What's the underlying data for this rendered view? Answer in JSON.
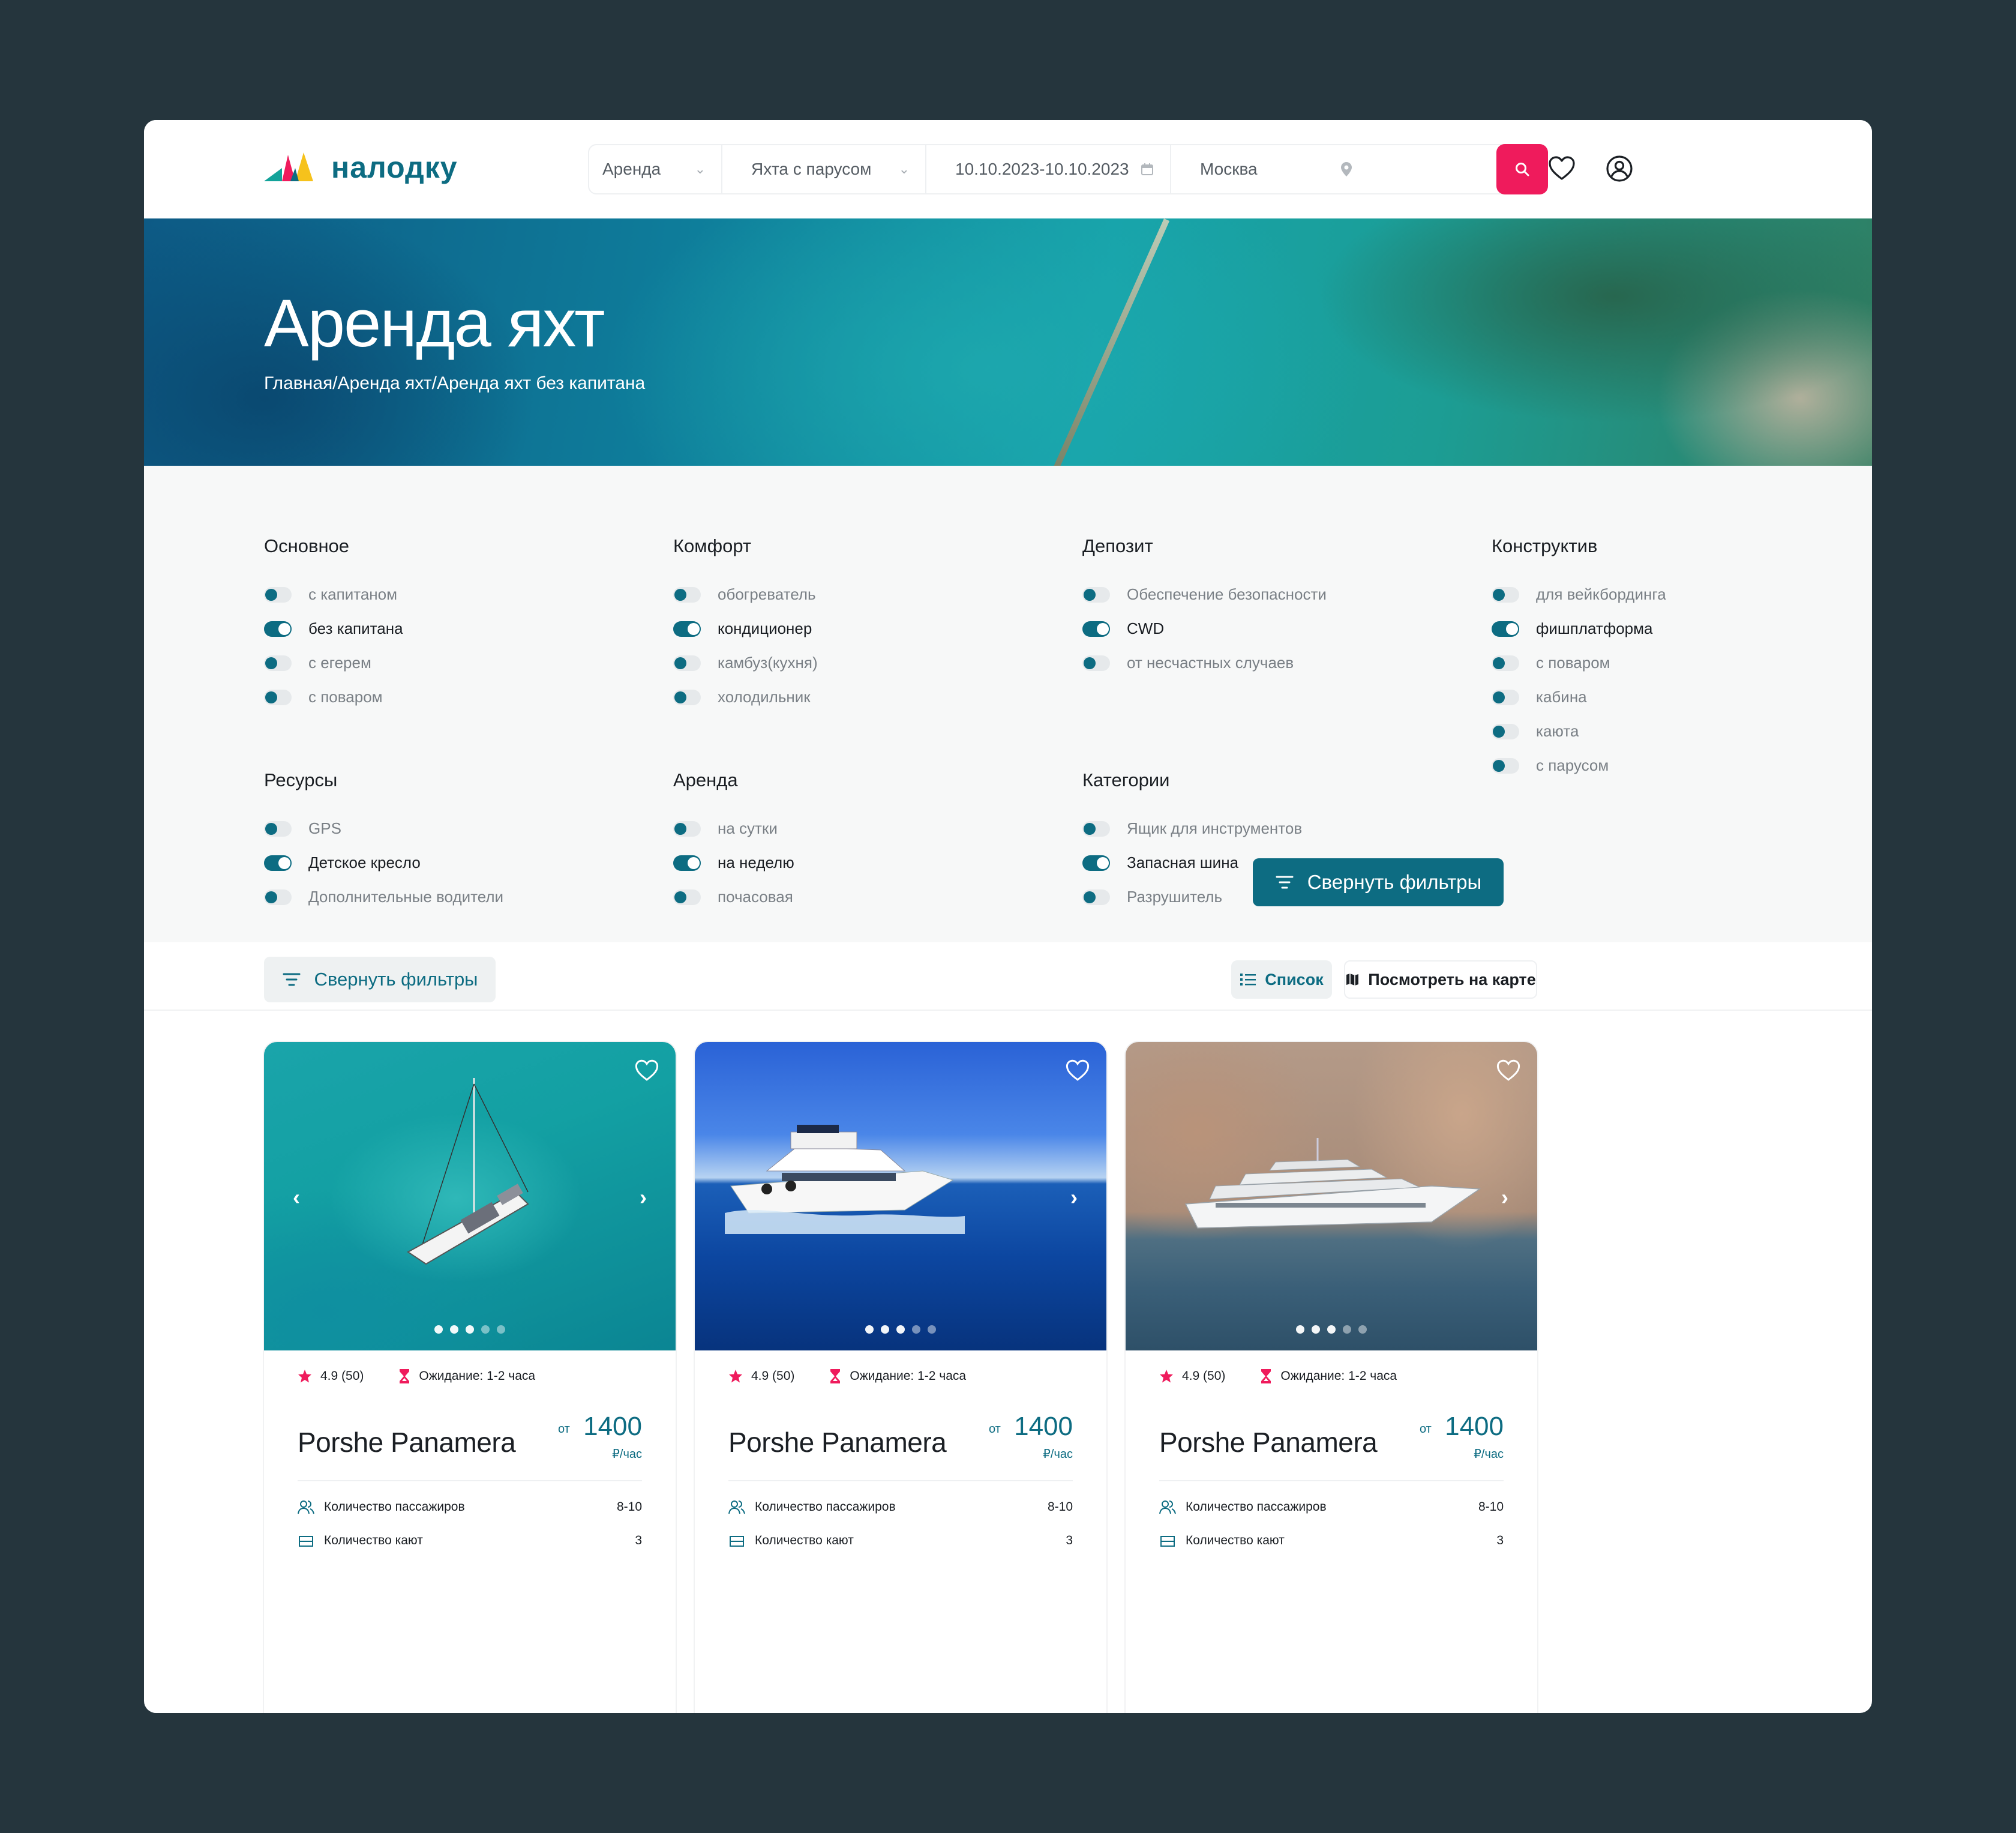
{
  "brand": {
    "name": "налодку",
    "colors": {
      "primary": "#0d6c82",
      "accent": "#ef1b5c",
      "yellow": "#f6c21c",
      "background": "#25353d"
    }
  },
  "search": {
    "type": "Аренда",
    "category": "Яхта с парусом",
    "dates": "10.10.2023-10.10.2023",
    "city": "Москва",
    "icons": {
      "type": "chevron-down-icon",
      "category": "chevron-down-icon",
      "dates": "calendar-icon",
      "city": "location-pin-icon",
      "button": "search-icon"
    }
  },
  "header": {
    "icons": [
      "heart-icon",
      "user-circle-icon"
    ]
  },
  "hero": {
    "title": "Аренда яхт",
    "breadcrumb": "Главная/Аренда яхт/Аренда яхт без капитана"
  },
  "filters": {
    "groups": [
      {
        "title": "Основное",
        "items": [
          {
            "label": "с капитаном",
            "on": false
          },
          {
            "label": "без капитана",
            "on": true
          },
          {
            "label": "с егерем",
            "on": false
          },
          {
            "label": "с поваром",
            "on": false
          }
        ]
      },
      {
        "title": "Комфорт",
        "items": [
          {
            "label": "обогреватель",
            "on": false
          },
          {
            "label": "кондиционер",
            "on": true
          },
          {
            "label": "камбуз(кухня)",
            "on": false
          },
          {
            "label": "холодильник",
            "on": false
          }
        ]
      },
      {
        "title": "Депозит",
        "items": [
          {
            "label": "Обеспечение безопасности",
            "on": false
          },
          {
            "label": "CWD",
            "on": true
          },
          {
            "label": "от несчастных случаев",
            "on": false
          }
        ]
      },
      {
        "title": "Конструктив",
        "items": [
          {
            "label": "для вейкбординга",
            "on": false
          },
          {
            "label": "фишплатформа",
            "on": true
          },
          {
            "label": "с поваром",
            "on": false
          },
          {
            "label": "кабина",
            "on": false
          },
          {
            "label": "каюта",
            "on": false
          },
          {
            "label": "с парусом",
            "on": false
          }
        ]
      },
      {
        "title": "Ресурсы",
        "items": [
          {
            "label": "GPS",
            "on": false
          },
          {
            "label": "Детское кресло",
            "on": true
          },
          {
            "label": "Дополнительные водители",
            "on": false
          }
        ]
      },
      {
        "title": "Аренда",
        "items": [
          {
            "label": "на сутки",
            "on": false
          },
          {
            "label": "на неделю",
            "on": true
          },
          {
            "label": "почасовая",
            "on": false
          }
        ]
      },
      {
        "title": "Категории",
        "items": [
          {
            "label": "Ящик для инструментов",
            "on": false
          },
          {
            "label": "Запасная шина",
            "on": true
          },
          {
            "label": "Разрушитель",
            "on": false
          }
        ]
      }
    ],
    "collapse_label": "Свернуть фильтры"
  },
  "toolbar": {
    "collapse_label": "Свернуть фильтры",
    "list_label": "Список",
    "map_label": "Посмотреть на карте"
  },
  "cards": [
    {
      "rating": "4.9 (50)",
      "wait": "Ожидание: 1-2 часа",
      "name": "Porshe Panamera",
      "price_from": "от",
      "price": "1400",
      "unit": "₽/час",
      "specs": [
        {
          "label": "Количество пассажиров",
          "value": "8-10"
        },
        {
          "label": "Количество кают",
          "value": "3"
        }
      ],
      "photo": "sailboat-on-turquoise-water",
      "slides_total": 5,
      "slide_active": 1
    },
    {
      "rating": "4.9 (50)",
      "wait": "Ожидание: 1-2 часа",
      "name": "Porshe Panamera",
      "price_from": "от",
      "price": "1400",
      "unit": "₽/час",
      "specs": [
        {
          "label": "Количество пассажиров",
          "value": "8-10"
        },
        {
          "label": "Количество кают",
          "value": "3"
        }
      ],
      "photo": "motor-yacht-on-blue-sea",
      "slides_total": 5,
      "slide_active": 1
    },
    {
      "rating": "4.9 (50)",
      "wait": "Ожидание: 1-2 часа",
      "name": "Porshe Panamera",
      "price_from": "от",
      "price": "1400",
      "unit": "₽/час",
      "specs": [
        {
          "label": "Количество пассажиров",
          "value": "8-10"
        },
        {
          "label": "Количество кают",
          "value": "3"
        }
      ],
      "photo": "superyacht-near-cliffs",
      "slides_total": 5,
      "slide_active": 1
    }
  ]
}
